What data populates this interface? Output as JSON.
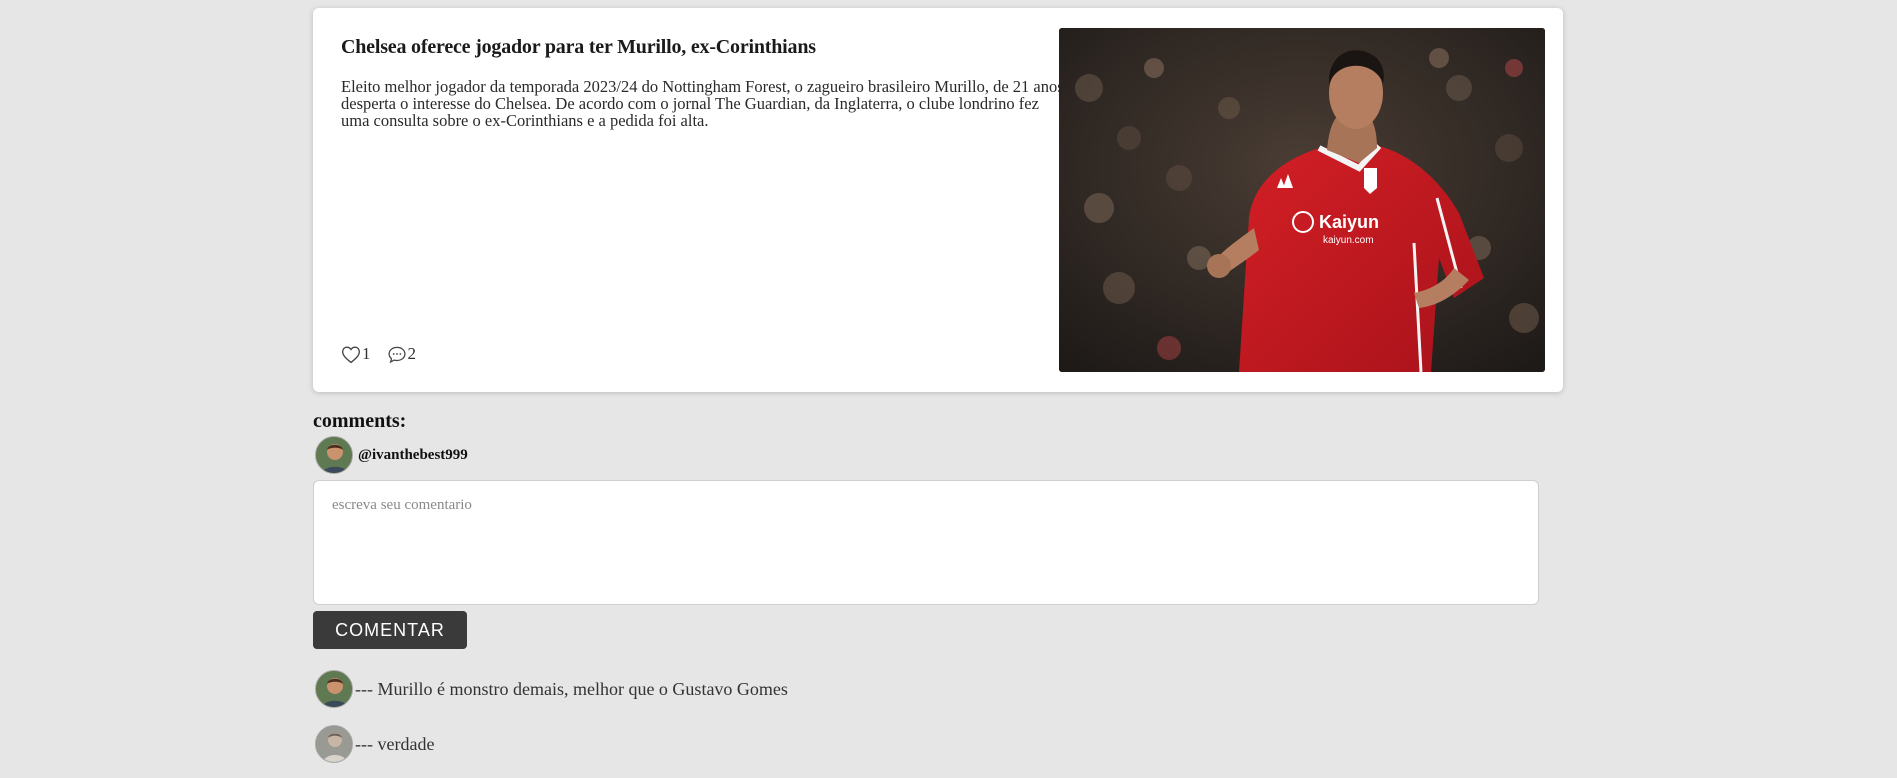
{
  "post": {
    "title": "Chelsea oferece jogador para ter Murillo, ex-Corinthians",
    "body": "Eleito melhor jogador da temporada 2023/24 do Nottingham Forest, o zagueiro brasileiro Murillo, de 21 anos, desperta o interesse do Chelsea. De acordo com o jornal The Guardian, da Inglaterra, o clube londrino fez uma consulta sobre o ex-Corinthians e a pedida foi alta.",
    "likes": "1",
    "comments_count": "2",
    "image_alt": "Murillo Nottingham Forest",
    "image_sponsor": "Kaiyun",
    "image_sponsor_sub": "kaiyun.com"
  },
  "comments_section": {
    "heading": "comments:",
    "current_user": "@ivanthebest999",
    "input_placeholder": "escreva seu comentario",
    "submit_label": "COMENTAR",
    "items": [
      {
        "text": "--- Murillo é monstro demais, melhor que o Gustavo Gomes"
      },
      {
        "text": "--- verdade"
      }
    ]
  },
  "colors": {
    "page_bg": "#e6e6e6",
    "card_bg": "#ffffff",
    "button_bg": "#3a3a3a",
    "shirt_red": "#c8171e"
  },
  "icons": [
    "heart-icon",
    "comment-bubble-icon"
  ]
}
